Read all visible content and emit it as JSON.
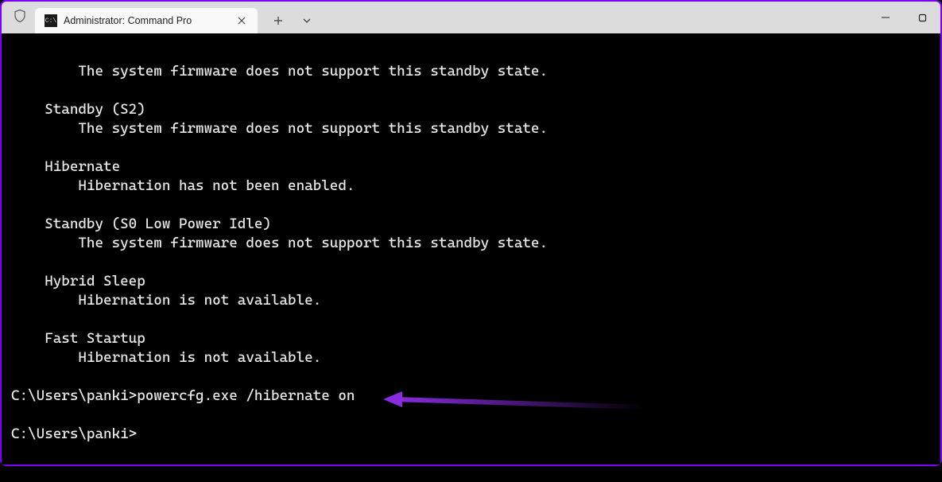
{
  "window": {
    "tab_title": "Administrator: Command Pro"
  },
  "terminal": {
    "output": "        The system firmware does not support this standby state.\n\n    Standby (S2)\n        The system firmware does not support this standby state.\n\n    Hibernate\n        Hibernation has not been enabled.\n\n    Standby (S0 Low Power Idle)\n        The system firmware does not support this standby state.\n\n    Hybrid Sleep\n        Hibernation is not available.\n\n    Fast Startup\n        Hibernation is not available.\n",
    "prompt1_path": "C:\\Users\\panki>",
    "prompt1_command": "powercfg.exe /hibernate on",
    "prompt2_path": "C:\\Users\\panki>",
    "prompt2_command": ""
  },
  "icons": {
    "tab_cmd_glyph": "C:\\"
  }
}
